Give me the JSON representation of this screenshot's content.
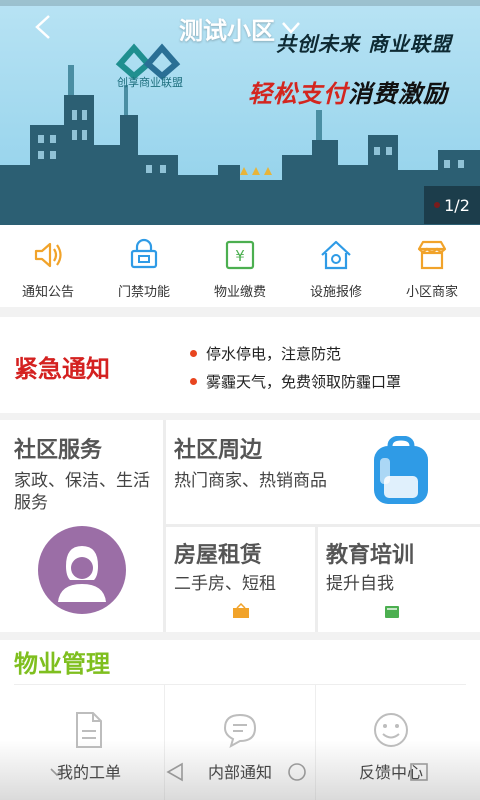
{
  "header": {
    "title": "测试小区",
    "banner_logo_text": "创享商业联盟",
    "slogan_line1": "共创未来 商业联盟",
    "slogan_line2_highlight": "轻松支付",
    "slogan_line2_rest": "消费激励",
    "pager_text": "1/2"
  },
  "quick_nav": [
    {
      "label": "通知公告",
      "icon": "speaker-icon"
    },
    {
      "label": "门禁功能",
      "icon": "door-lock-icon"
    },
    {
      "label": "物业缴费",
      "icon": "yen-bill-icon"
    },
    {
      "label": "设施报修",
      "icon": "house-wrench-icon"
    },
    {
      "label": "小区商家",
      "icon": "shop-icon"
    }
  ],
  "notice": {
    "title": "紧急通知",
    "items": [
      "停水停电，注意防范",
      "雾霾天气，免费领取防霾口罩"
    ]
  },
  "services": {
    "community_service": {
      "title": "社区服务",
      "subtitle": "家政、保洁、生活服务"
    },
    "nearby": {
      "title": "社区周边",
      "subtitle": "热门商家、热销商品"
    },
    "rental": {
      "title": "房屋租赁",
      "subtitle": "二手房、短租"
    },
    "education": {
      "title": "教育培训",
      "subtitle": "提升自我"
    }
  },
  "property": {
    "title": "物业管理",
    "items": [
      {
        "label": "我的工单",
        "icon": "document-icon"
      },
      {
        "label": "内部通知",
        "icon": "chat-bubble-icon"
      },
      {
        "label": "反馈中心",
        "icon": "smiley-icon"
      }
    ]
  },
  "colors": {
    "notice_red": "#d42120",
    "property_green": "#7fbf1f",
    "icon_orange": "#f1a32a",
    "icon_blue": "#2f9be6",
    "avatar_purple": "#9b6ea6"
  }
}
